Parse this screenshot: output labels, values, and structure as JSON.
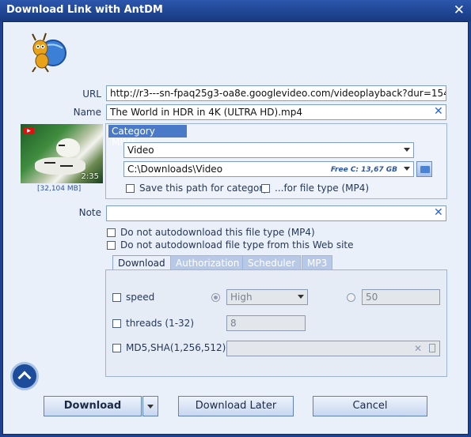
{
  "window": {
    "title": "Download Link with AntDM",
    "close_glyph": "✕"
  },
  "form": {
    "url_label": "URL",
    "url_value": "http://r3---sn-fpaq25g3-oa8e.googlevideo.com/videoplayback?dur=154.621&",
    "name_label": "Name",
    "name_value": "The World in HDR in 4K (ULTRA HD).mp4",
    "note_label": "Note",
    "note_value": "",
    "clear_glyph": "✕"
  },
  "thumbnail": {
    "duration": "2:35",
    "size": "[32,104 MB]",
    "play_badge": "▶"
  },
  "category": {
    "header": "Category MIME:",
    "type_value": "Video",
    "path_value": "C:\\Downloads\\Video",
    "free_space": "Free C: 13,67 GB",
    "save_path_label": "Save this path for category",
    "file_type_label": "...for file type (MP4)"
  },
  "options": {
    "no_autodownload_type": "Do not autodownload this file type (MP4)",
    "no_autodownload_site": "Do not autodownload file type from this Web site"
  },
  "tabs": [
    {
      "label": "Download"
    },
    {
      "label": "Authorization"
    },
    {
      "label": "Scheduler"
    },
    {
      "label": "MP3"
    }
  ],
  "download_tab": {
    "speed_label": "speed",
    "speed_select": "High",
    "speed_value": "50",
    "threads_label": "threads (1-32)",
    "threads_value": "8",
    "hash_label": "MD5,SHA(1,256,512)",
    "hash_value": ""
  },
  "buttons": {
    "download": "Download",
    "download_later": "Download Later",
    "cancel": "Cancel"
  },
  "colors": {
    "titlebar": "#1e4290",
    "accent": "#4a79c7"
  }
}
